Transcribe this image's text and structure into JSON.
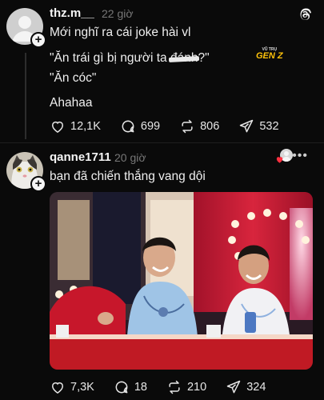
{
  "post1": {
    "username": "thz.m__",
    "time": "22 giờ",
    "lines": [
      "Mới nghĩ ra cái joke hài vl",
      "\"Ăn trái gì bị người ta ",
      "đánh",
      "?\"",
      "\"Ăn cóc\"",
      "Ahahaa"
    ],
    "watermark_small": "VŨ TRỤ",
    "watermark_big": "GEN Z",
    "likes": "12,1K",
    "comments": "699",
    "reposts": "806",
    "shares": "532"
  },
  "post2": {
    "username": "qanne1711",
    "time": "20 giờ",
    "more_label": "•••",
    "text": "bạn đã chiến thắng vang dội",
    "likes": "7,3K",
    "comments": "18",
    "reposts": "210",
    "shares": "324"
  },
  "colors": {
    "background": "#0a0a0a",
    "text": "#f3f3f3",
    "muted": "#777777",
    "heart_red": "#ff3040",
    "watermark_yellow": "#ffc30a"
  },
  "icons": [
    "threads-logo-icon",
    "heart-icon",
    "comment-icon",
    "repost-icon",
    "share-icon",
    "plus-icon",
    "more-icon"
  ]
}
